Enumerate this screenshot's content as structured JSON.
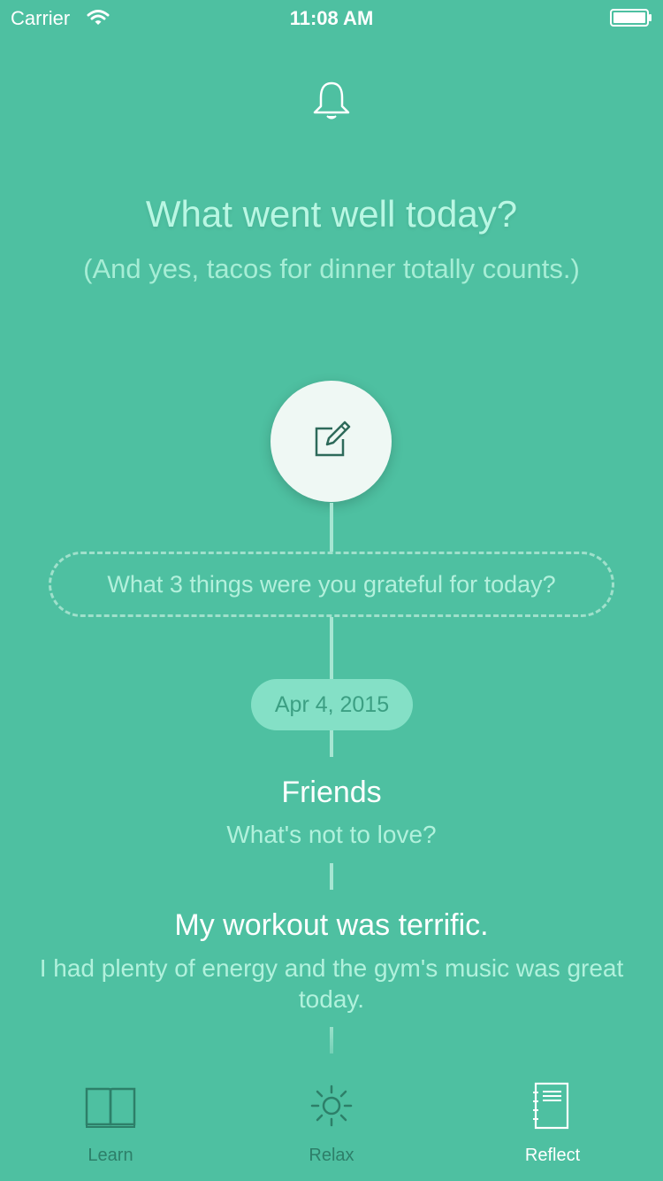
{
  "status_bar": {
    "carrier": "Carrier",
    "time": "11:08 AM"
  },
  "header": {
    "title": "What went well today?",
    "subtitle": "(And yes, tacos for dinner totally counts.)"
  },
  "prompt": {
    "text": "What 3 things were you grateful for today?"
  },
  "entry_date": "Apr 4, 2015",
  "entries": [
    {
      "title": "Friends",
      "detail": "What's not to love?"
    },
    {
      "title": "My workout was terrific.",
      "detail": "I had plenty of energy and the gym's music was great today."
    }
  ],
  "tabs": [
    {
      "label": "Learn",
      "icon": "book-icon",
      "active": false
    },
    {
      "label": "Relax",
      "icon": "sun-icon",
      "active": false
    },
    {
      "label": "Reflect",
      "icon": "notebook-icon",
      "active": true
    }
  ],
  "colors": {
    "background": "#4ec0a1",
    "accent_light": "#b9f7e3",
    "tab_inactive": "#2d7f69"
  }
}
